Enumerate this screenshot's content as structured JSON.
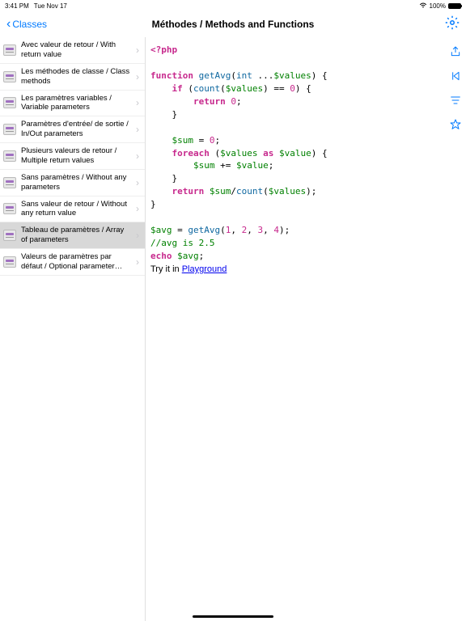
{
  "statusBar": {
    "time": "3:41 PM",
    "date": "Tue Nov 17",
    "batteryPct": "100%"
  },
  "nav": {
    "backLabel": "Classes",
    "title": "Méthodes / Methods and Functions"
  },
  "sidebar": {
    "items": [
      {
        "label": "Avec valeur de retour / With return value",
        "selected": false
      },
      {
        "label": "Les méthodes de classe / Class methods",
        "selected": false
      },
      {
        "label": "Les paramètres variables / Variable parameters",
        "selected": false
      },
      {
        "label": "Paramètres d'entrée/ de sortie / In/Out parameters",
        "selected": false
      },
      {
        "label": "Plusieurs valeurs de retour / Multiple return values",
        "selected": false
      },
      {
        "label": "Sans paramètres / Without any parameters",
        "selected": false
      },
      {
        "label": "Sans valeur de retour / Without any return value",
        "selected": false
      },
      {
        "label": "Tableau de paramètres / Array of parameters",
        "selected": true
      },
      {
        "label": "Valeurs de paramètres par défaut / Optional parameter…",
        "selected": false
      }
    ]
  },
  "code": {
    "phpOpen": "<?php",
    "kwFunction": "function",
    "fnGetAvg": "getAvg",
    "typeInt": "int",
    "varValues": "$values",
    "kwIf": "if",
    "fnCount": "count",
    "kwReturn": "return",
    "num0": "0",
    "varSum": "$sum",
    "kwForeach": "foreach",
    "kwAs": "as",
    "varValue": "$value",
    "varAvg": "$avg",
    "num1": "1",
    "num2": "2",
    "num3": "3",
    "num4": "4",
    "commentAvg": "//avg is 2.5",
    "kwEcho": "echo",
    "tryItPrefix": "Try it in ",
    "playgroundLink": "Playground"
  }
}
